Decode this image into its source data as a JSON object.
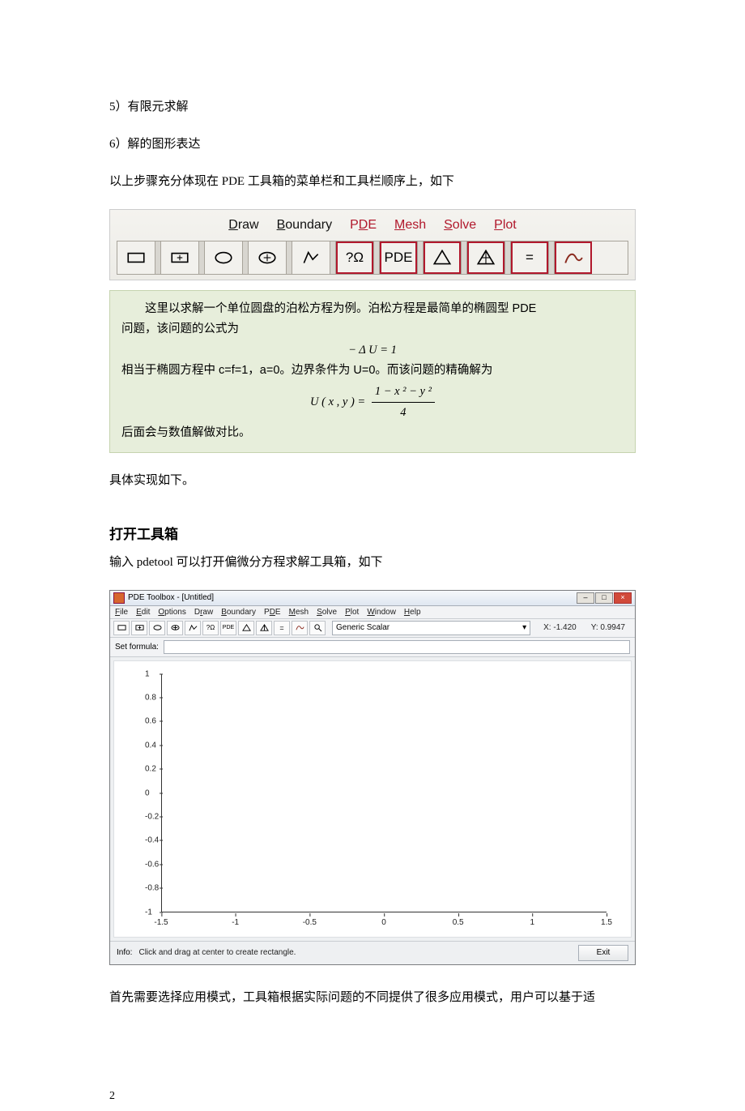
{
  "body": {
    "item5": "5）有限元求解",
    "item6": "6）解的图形表达",
    "intro_toolbar": "以上步骤充分体现在 PDE 工具箱的菜单栏和工具栏顺序上，如下",
    "impl_follows": "具体实现如下。",
    "sec_open": "打开工具箱",
    "open_desc": "输入 pdetool 可以打开偏微分方程求解工具箱，如下",
    "select_mode": "首先需要选择应用模式，工具箱根据实际问题的不同提供了很多应用模式，用户可以基于适",
    "page_num": "2"
  },
  "fig_toolbar": {
    "menus": [
      "Draw",
      "Boundary",
      "PDE",
      "Mesh",
      "Solve",
      "Plot"
    ],
    "label_omega": "?Ω",
    "label_pde": "PDE",
    "label_eq": "="
  },
  "example": {
    "line1_a": "这里以求解一个单位圆盘的泊松方程为例。泊松方程是最简单的椭圆型 PDE",
    "line1_b": "问题，该问题的公式为",
    "eqn1": "− Δ U  = 1",
    "line2": "相当于椭圆方程中 c=f=1，a=0。边界条件为 U=0。而该问题的精确解为",
    "eqn2_lhs": "U  ( x , y ) =",
    "eqn2_num": "1 − x ² − y ²",
    "eqn2_den": "4",
    "line3": "后面会与数值解做对比。"
  },
  "matlab": {
    "title": "PDE Toolbox - [Untitled]",
    "menubar": [
      "File",
      "Edit",
      "Options",
      "Draw",
      "Boundary",
      "PDE",
      "Mesh",
      "Solve",
      "Plot",
      "Window",
      "Help"
    ],
    "tb_omega": "?Ω",
    "tb_pde": "PDE",
    "tb_eq": "=",
    "mode": "Generic Scalar",
    "coord_x": "X: -1.420",
    "coord_y": "Y: 0.9947",
    "setformula": "Set formula:",
    "info_label": "Info:",
    "info_text": "Click and drag at center to create rectangle.",
    "exit": "Exit"
  },
  "chart_data": {
    "type": "scatter",
    "title": "",
    "xlabel": "",
    "ylabel": "",
    "xlim": [
      -1.5,
      1.5
    ],
    "ylim": [
      -1,
      1
    ],
    "xticks": [
      -1.5,
      -1,
      -0.5,
      0,
      0.5,
      1,
      1.5
    ],
    "yticks": [
      -1,
      -0.8,
      -0.6,
      -0.4,
      -0.2,
      0,
      0.2,
      0.4,
      0.6,
      0.8,
      1
    ],
    "ytick_labels": [
      "-1",
      "-0.8",
      "-0.6",
      "-0.4",
      "-0.2",
      "0",
      "0.2",
      "0.4",
      "0.6",
      "0.8",
      "1"
    ],
    "xtick_labels": [
      "-1.5",
      "-1",
      "-0.5",
      "0",
      "0.5",
      "1",
      "1.5"
    ],
    "series": []
  }
}
